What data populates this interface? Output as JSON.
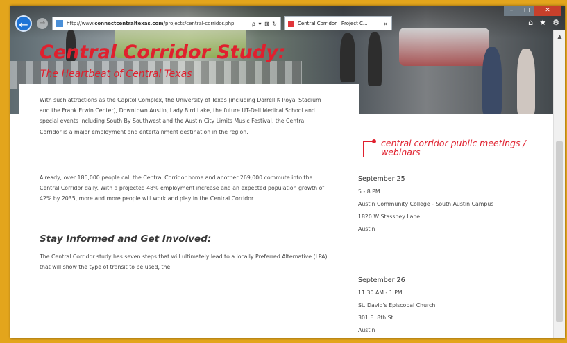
{
  "browser": {
    "url_prefix": "http://www.",
    "url_domain": "connectcentraltexas.com",
    "url_suffix": "/projects/central-corridor.php",
    "address_tools": "ρ ▾ ⊠ ↻",
    "tab_title": "Central Corridor | Project C...",
    "tab_close": "×",
    "back_icon": "←",
    "forward_icon": "→",
    "window_controls": {
      "minimize": "–",
      "maximize": "▢",
      "close": "✕"
    },
    "command_icons": {
      "home": "⌂",
      "favorites": "★",
      "tools": "⚙"
    },
    "scroll_up": "▲"
  },
  "page": {
    "title": "Central Corridor Study:",
    "subtitle": "The Heartbeat of Central Texas",
    "paragraph1": "With such attractions as the Capitol Complex, the University of Texas (including Darrell K Royal Stadium and the Frank Erwin Center), Downtown Austin, Lady Bird Lake, the future UT-Dell Medical School and special events including South By Southwest and the Austin City Limits Music Festival, the Central Corridor is a major employment and entertainment destination in the region.",
    "paragraph2": "Already, over 186,000 people call the Central Corridor home and another 269,000 commute into the Central Corridor daily. With a projected 48% employment increase and an expected population growth of 42% by 2035, more and more people will work and play in the Central Corridor.",
    "section_heading": "Stay Informed and Get Involved:",
    "paragraph3": "The Central Corridor study has seven steps that will ultimately lead to a locally Preferred Alternative (LPA) that will show the type of transit to be used, the"
  },
  "meetings": {
    "heading": "central corridor public meetings / webinars",
    "events": [
      {
        "date": "September 25",
        "time": "5 - 8 PM",
        "venue": "Austin Community College - South Austin Campus",
        "address": "1820 W Stassney Lane",
        "city": "Austin"
      },
      {
        "date": "September 26",
        "time": "11:30 AM - 1 PM",
        "venue": "St. David's Episcopal Church",
        "address": "301 E. 8th St.",
        "city": "Austin"
      }
    ]
  },
  "colors": {
    "accent": "#e0202e",
    "background_frame": "#e3a51c",
    "browser_back": "#1f74d6"
  }
}
